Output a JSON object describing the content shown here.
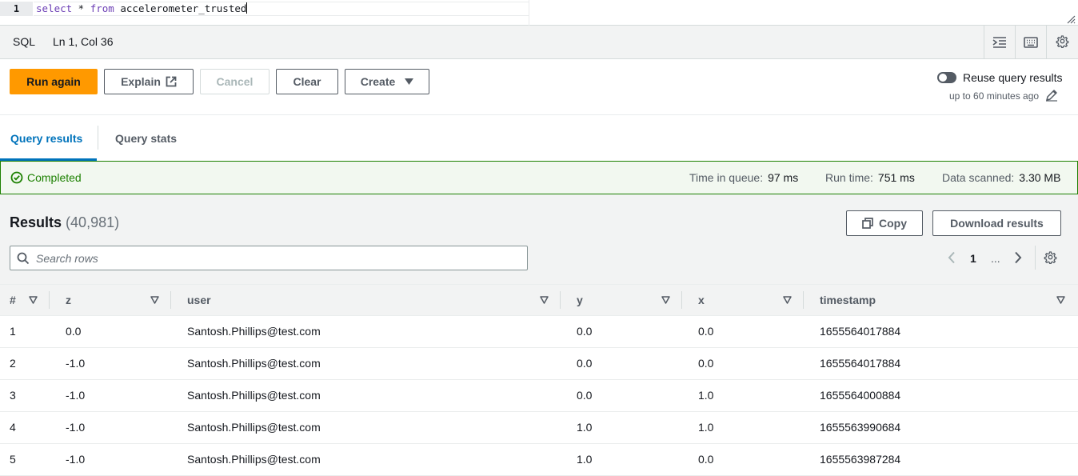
{
  "editor": {
    "line_number": "1",
    "code_keyword_1": "select",
    "code_star": " * ",
    "code_keyword_2": "from",
    "code_table": " accelerometer_trusted"
  },
  "statusbar": {
    "language": "SQL",
    "cursor_position": "Ln 1, Col 36",
    "icons": [
      "format-icon",
      "keyboard-icon",
      "settings-icon"
    ]
  },
  "actions": {
    "run_again": "Run again",
    "explain": "Explain",
    "cancel": "Cancel",
    "clear": "Clear",
    "create": "Create",
    "reuse_label": "Reuse query results",
    "reuse_sub": "up to 60 minutes ago",
    "reuse_enabled": false
  },
  "tabs": [
    {
      "label": "Query results",
      "active": true
    },
    {
      "label": "Query stats",
      "active": false
    }
  ],
  "banner": {
    "status": "Completed",
    "queue_label": "Time in queue:",
    "queue_value": "97 ms",
    "run_label": "Run time:",
    "run_value": "751 ms",
    "scanned_label": "Data scanned:",
    "scanned_value": "3.30 MB"
  },
  "results": {
    "title": "Results",
    "count": "(40,981)",
    "copy": "Copy",
    "download": "Download results",
    "search_placeholder": "Search rows",
    "current_page": "1",
    "ellipsis": "..."
  },
  "table": {
    "columns": [
      "#",
      "z",
      "user",
      "y",
      "x",
      "timestamp"
    ],
    "rows": [
      [
        "1",
        "0.0",
        "Santosh.Phillips@test.com",
        "0.0",
        "0.0",
        "1655564017884"
      ],
      [
        "2",
        "-1.0",
        "Santosh.Phillips@test.com",
        "0.0",
        "0.0",
        "1655564017884"
      ],
      [
        "3",
        "-1.0",
        "Santosh.Phillips@test.com",
        "0.0",
        "1.0",
        "1655564000884"
      ],
      [
        "4",
        "-1.0",
        "Santosh.Phillips@test.com",
        "1.0",
        "1.0",
        "1655563990684"
      ],
      [
        "5",
        "-1.0",
        "Santosh.Phillips@test.com",
        "1.0",
        "0.0",
        "1655563987284"
      ]
    ]
  },
  "colors": {
    "primary": "#ff9900",
    "link": "#0073bb",
    "success": "#1d8102"
  }
}
